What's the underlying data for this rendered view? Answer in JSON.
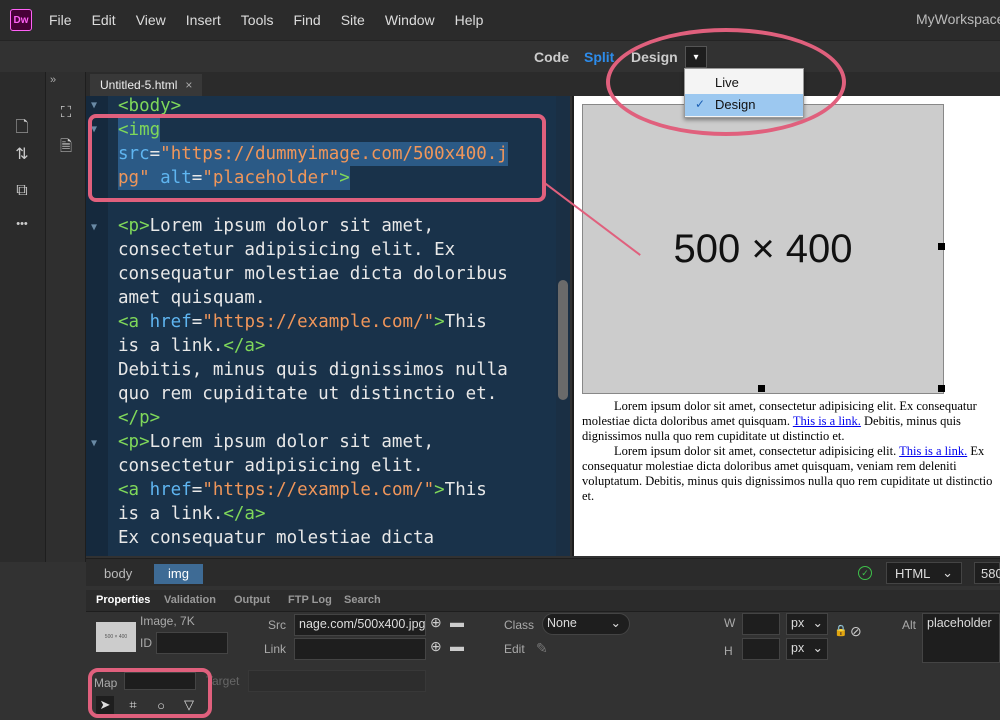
{
  "menubar": {
    "logo": "Dw",
    "items": [
      "File",
      "Edit",
      "View",
      "Insert",
      "Tools",
      "Find",
      "Site",
      "Window",
      "Help"
    ],
    "workspace": "MyWorkspace"
  },
  "viewbar": {
    "code": "Code",
    "split": "Split",
    "design": "Design",
    "caret": "▾"
  },
  "dropdown": {
    "items": [
      "Live",
      "Design"
    ],
    "selected": "Design"
  },
  "left_strip": {
    "chevron": "»",
    "more": "•••"
  },
  "tab": {
    "title": "Untitled-5.html",
    "close": "×"
  },
  "code": {
    "l1": "<body>",
    "l2a": "<img",
    "l3a": "src",
    "l3b": "=",
    "l3c": "\"https://dummyimage.com/500x400.j",
    "l4a": "pg\"",
    "l4b": " alt",
    "l4c": "=",
    "l4d": "\"placeholder\"",
    "l4e": ">",
    "l5a": "<p>",
    "l5b": "Lorem ipsum dolor sit amet,",
    "l6": "consectetur adipisicing elit. Ex",
    "l7": "consequatur molestiae dicta doloribus",
    "l8": "amet quisquam.",
    "l9a": "<a",
    "l9b": " href",
    "l9c": "=",
    "l9d": "\"https://example.com/\"",
    "l9e": ">",
    "l9f": "This",
    "l10a": "is a link.",
    "l10b": "</a>",
    "l11": "Debitis, minus quis dignissimos nulla",
    "l12": "quo rem cupiditate ut distinctio et.",
    "l13": "</p>",
    "l14a": "<p>",
    "l14b": "Lorem ipsum dolor sit amet,",
    "l15": "consectetur adipisicing elit.",
    "l16a": "<a",
    "l16b": " href",
    "l16c": "=",
    "l16d": "\"https://example.com/\"",
    "l16e": ">",
    "l16f": "This",
    "l17a": "is a link.",
    "l17b": "</a>",
    "l18": "Ex consequatur molestiae dicta"
  },
  "design": {
    "image_label": "500 × 400",
    "p1a": "Lorem ipsum dolor sit amet, consectetur adipisicing elit. Ex consequatur molestiae dicta doloribus amet quisquam. ",
    "p1link": "This is a link.",
    "p1b": " Debitis, minus quis dignissimos nulla quo rem cupiditate ut distinctio et.",
    "p2a": "Lorem ipsum dolor sit amet, consectetur adipisicing elit. ",
    "p2link": "This is a link.",
    "p2b": " Ex consequatur molestiae dicta doloribus amet quisquam, veniam rem deleniti voluptatum. Debitis, minus quis dignissimos nulla quo rem cupiditate ut distinctio et."
  },
  "tagbar": {
    "body": "body",
    "img": "img",
    "lang": "HTML",
    "width": "580"
  },
  "panel_tabs": [
    "Properties",
    "Validation",
    "Output",
    "FTP Log",
    "Search"
  ],
  "properties": {
    "type": "Image, 7K",
    "thumb_text": "500 × 400",
    "id_label": "ID",
    "id_value": "",
    "src_label": "Src",
    "src_value": "nage.com/500x400.jpg",
    "link_label": "Link",
    "link_value": "",
    "class_label": "Class",
    "class_value": "None",
    "edit_label": "Edit",
    "w_label": "W",
    "h_label": "H",
    "w_value": "",
    "h_value": "",
    "unit": "px",
    "alt_label": "Alt",
    "alt_value": "placeholder",
    "map_label": "Map",
    "map_value": "",
    "target_label": "Target",
    "target_value": ""
  },
  "colors": {
    "annotation": "#e0607d",
    "code_bg": "#19324a",
    "selection": "#2b5a86",
    "accent_blue": "#3e6b95"
  }
}
